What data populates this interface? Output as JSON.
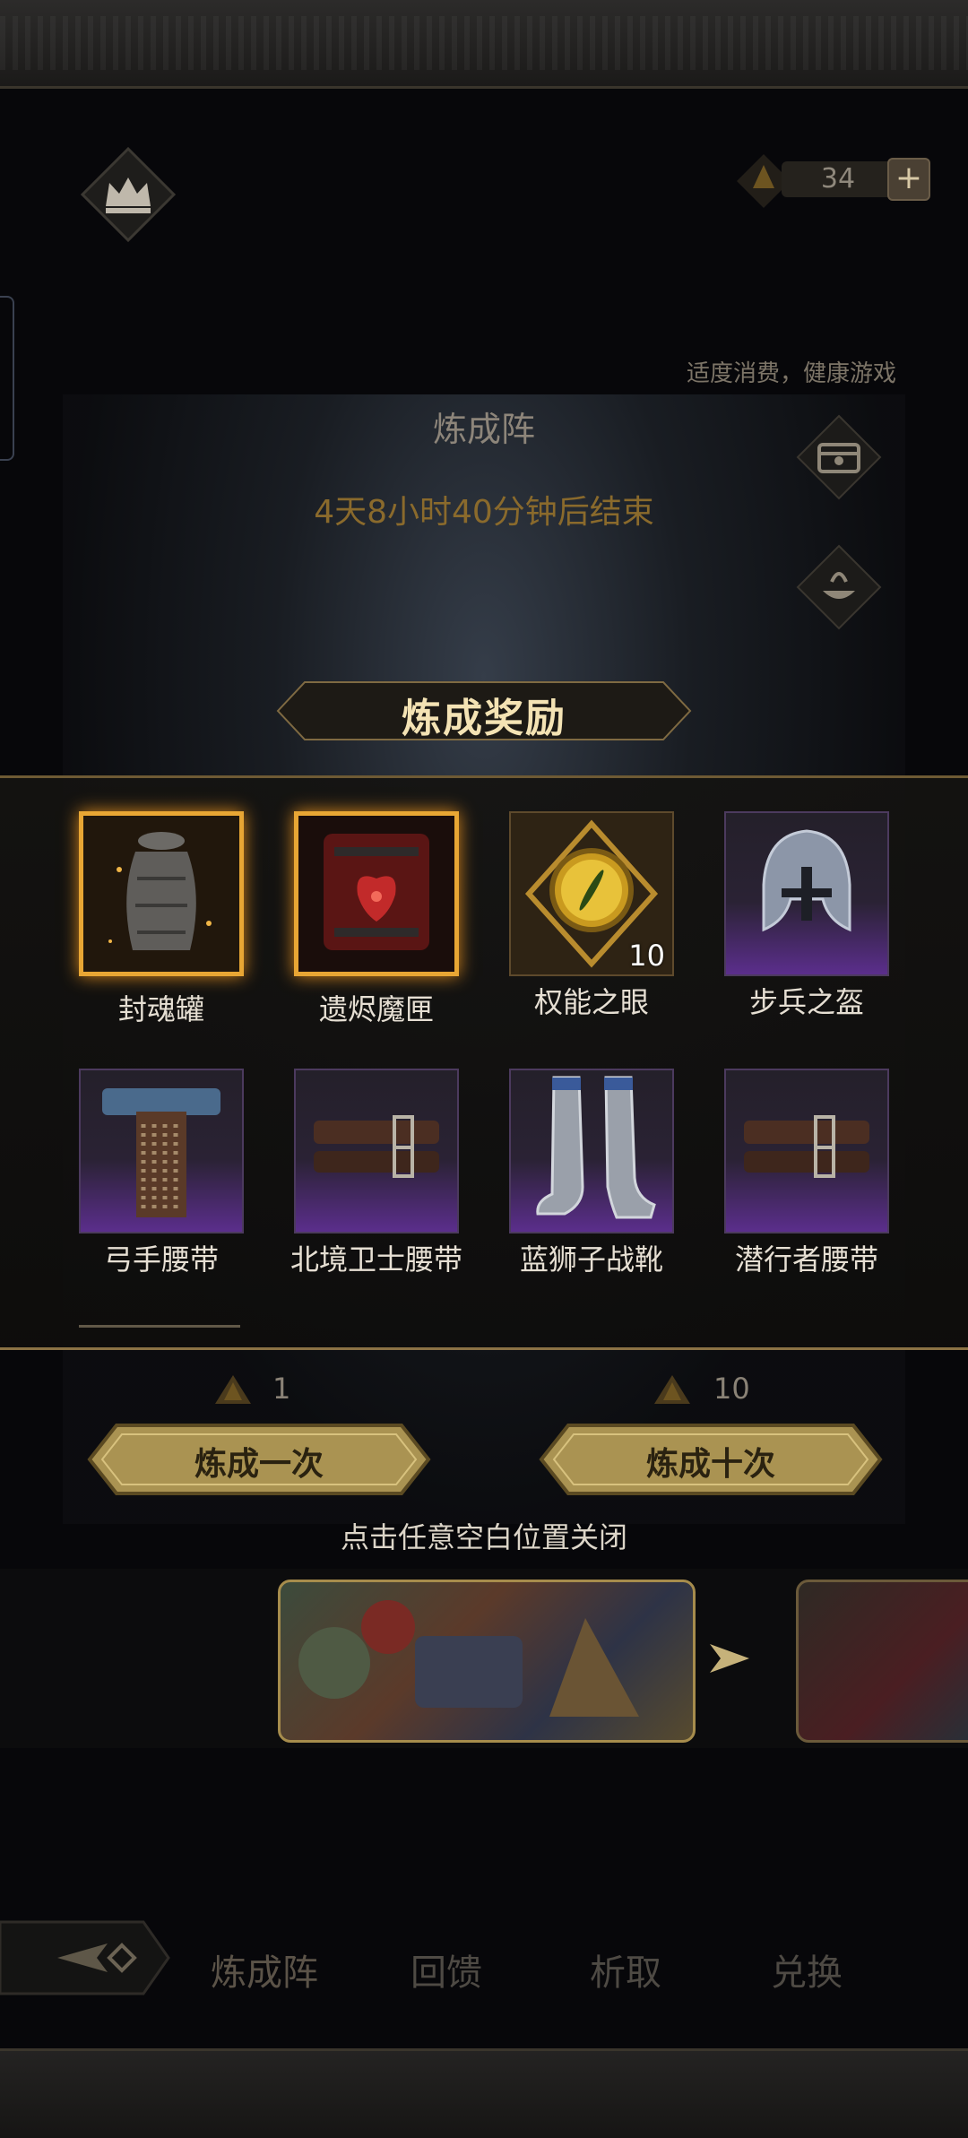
{
  "header": {
    "gem_count": "34",
    "plus_label": "+"
  },
  "notice": "适度消费，健康游戏",
  "panel": {
    "title": "炼成阵",
    "countdown": "4天8小时40分钟后结束"
  },
  "rewards": {
    "title": "炼成奖励",
    "items": [
      {
        "name": "封魂罐",
        "rarity": "legendary",
        "qty": ""
      },
      {
        "name": "遗烬魔匣",
        "rarity": "legendary",
        "qty": ""
      },
      {
        "name": "权能之眼",
        "rarity": "orange",
        "qty": "10"
      },
      {
        "name": "步兵之盔",
        "rarity": "purple",
        "qty": ""
      },
      {
        "name": "弓手腰带",
        "rarity": "purple",
        "qty": ""
      },
      {
        "name": "北境卫士腰带",
        "rarity": "purple",
        "qty": ""
      },
      {
        "name": "蓝狮子战靴",
        "rarity": "purple",
        "qty": ""
      },
      {
        "name": "潜行者腰带",
        "rarity": "purple",
        "qty": ""
      }
    ]
  },
  "draw": {
    "once": {
      "cost": "1",
      "label": "炼成一次"
    },
    "ten": {
      "cost": "10",
      "label": "炼成十次"
    }
  },
  "close_hint": "点击任意空白位置关闭",
  "nav": {
    "tabs": [
      "炼成阵",
      "回馈",
      "析取",
      "兑换"
    ],
    "active": 0
  },
  "colors": {
    "gold": "#e8a634",
    "purple": "#5b2e8c",
    "button": "#b9a15c"
  },
  "icons": [
    "crown-icon",
    "gem-icon",
    "chest-icon",
    "pot-icon",
    "arrow-right-icon"
  ]
}
